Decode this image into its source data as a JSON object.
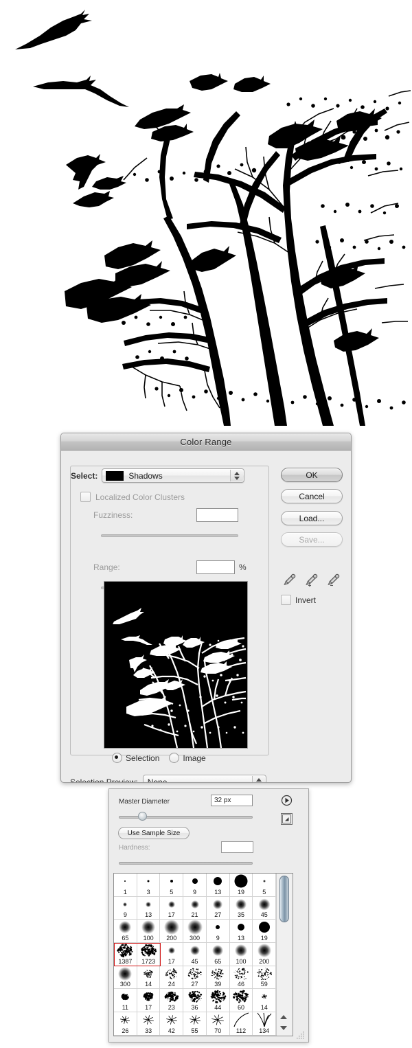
{
  "photo": {
    "name": "birds-in-tree-silhouette",
    "description": "High-contrast black and white photograph of crows perched and flying around bare tree branches",
    "foreground_color": "#000000",
    "background_color": "#ffffff"
  },
  "color_range_dialog": {
    "title": "Color Range",
    "select_label": "Select:",
    "select_value": "Shadows",
    "select_swatch_color": "#000000",
    "localized_color_clusters_label": "Localized Color Clusters",
    "localized_color_clusters_checked": false,
    "fuzziness_label": "Fuzziness:",
    "fuzziness_value": "",
    "range_label": "Range:",
    "range_value": "",
    "range_unit": "%",
    "preview_mode_selection": "Selection",
    "preview_mode_image": "Image",
    "preview_mode_active": "Selection",
    "selection_preview_label": "Selection Preview:",
    "selection_preview_value": "None",
    "invert_label": "Invert",
    "invert_checked": false,
    "buttons": {
      "ok": "OK",
      "cancel": "Cancel",
      "load": "Load...",
      "save": "Save...",
      "save_disabled": true,
      "ok_is_default": true
    },
    "eyedroppers": [
      {
        "name": "eyedropper-icon",
        "mode": "replace"
      },
      {
        "name": "eyedropper-add-icon",
        "mode": "add"
      },
      {
        "name": "eyedropper-subtract-icon",
        "mode": "subtract"
      }
    ]
  },
  "brush_panel": {
    "master_diameter_label": "Master Diameter",
    "master_diameter_value": "32 px",
    "master_diameter_slider_percent": 15,
    "use_sample_size_label": "Use Sample Size",
    "hardness_label": "Hardness:",
    "hardness_value": "",
    "hardness_disabled": true,
    "menu_icon": "panel-menu-icon",
    "preset_icon": "preset-manager-icon",
    "selected_brush_indices": [
      21,
      22
    ],
    "brushes": [
      {
        "size": "1",
        "kind": "hard",
        "r": 1
      },
      {
        "size": "3",
        "kind": "hard",
        "r": 1.5
      },
      {
        "size": "5",
        "kind": "hard",
        "r": 2
      },
      {
        "size": "9",
        "kind": "hard",
        "r": 4
      },
      {
        "size": "13",
        "kind": "hard",
        "r": 6
      },
      {
        "size": "19",
        "kind": "hard",
        "r": 9.5
      },
      {
        "size": "5",
        "kind": "soft",
        "r": 2
      },
      {
        "size": "9",
        "kind": "soft",
        "r": 3
      },
      {
        "size": "13",
        "kind": "soft",
        "r": 4
      },
      {
        "size": "17",
        "kind": "soft",
        "r": 5
      },
      {
        "size": "21",
        "kind": "soft",
        "r": 6
      },
      {
        "size": "27",
        "kind": "soft",
        "r": 7
      },
      {
        "size": "35",
        "kind": "soft",
        "r": 8
      },
      {
        "size": "45",
        "kind": "soft",
        "r": 8.5
      },
      {
        "size": "65",
        "kind": "soft",
        "r": 9
      },
      {
        "size": "100",
        "kind": "soft",
        "r": 10
      },
      {
        "size": "200",
        "kind": "soft",
        "r": 11
      },
      {
        "size": "300",
        "kind": "soft",
        "r": 11.5
      },
      {
        "size": "9",
        "kind": "hard",
        "r": 3
      },
      {
        "size": "13",
        "kind": "hard",
        "r": 5
      },
      {
        "size": "19",
        "kind": "hard",
        "r": 8
      },
      {
        "size": "1387",
        "kind": "texture-scatter",
        "r": 13
      },
      {
        "size": "1723",
        "kind": "texture-scatter",
        "r": 13
      },
      {
        "size": "17",
        "kind": "soft",
        "r": 5
      },
      {
        "size": "45",
        "kind": "soft",
        "r": 7
      },
      {
        "size": "65",
        "kind": "soft",
        "r": 8
      },
      {
        "size": "100",
        "kind": "soft",
        "r": 9
      },
      {
        "size": "200",
        "kind": "soft",
        "r": 10
      },
      {
        "size": "300",
        "kind": "soft",
        "r": 10
      },
      {
        "size": "14",
        "kind": "spatter-fine",
        "r": 7
      },
      {
        "size": "24",
        "kind": "spatter-fine",
        "r": 9
      },
      {
        "size": "27",
        "kind": "spatter-fine",
        "r": 10
      },
      {
        "size": "39",
        "kind": "spatter-fine",
        "r": 10
      },
      {
        "size": "46",
        "kind": "spatter-fine",
        "r": 11
      },
      {
        "size": "59",
        "kind": "spatter-fine",
        "r": 11
      },
      {
        "size": "11",
        "kind": "spatter-dense",
        "r": 5
      },
      {
        "size": "17",
        "kind": "spatter-dense",
        "r": 7
      },
      {
        "size": "23",
        "kind": "spatter-dense",
        "r": 9
      },
      {
        "size": "36",
        "kind": "spatter-dense",
        "r": 10
      },
      {
        "size": "44",
        "kind": "spatter-dense",
        "r": 11
      },
      {
        "size": "60",
        "kind": "spatter-dense",
        "r": 11
      },
      {
        "size": "14",
        "kind": "star",
        "r": 4
      },
      {
        "size": "26",
        "kind": "star",
        "r": 7
      },
      {
        "size": "33",
        "kind": "star",
        "r": 8
      },
      {
        "size": "42",
        "kind": "star",
        "r": 8
      },
      {
        "size": "55",
        "kind": "star",
        "r": 8
      },
      {
        "size": "70",
        "kind": "star",
        "r": 9
      },
      {
        "size": "112",
        "kind": "grass-curve",
        "r": 11
      },
      {
        "size": "134",
        "kind": "grass-blades",
        "r": 11
      }
    ]
  }
}
